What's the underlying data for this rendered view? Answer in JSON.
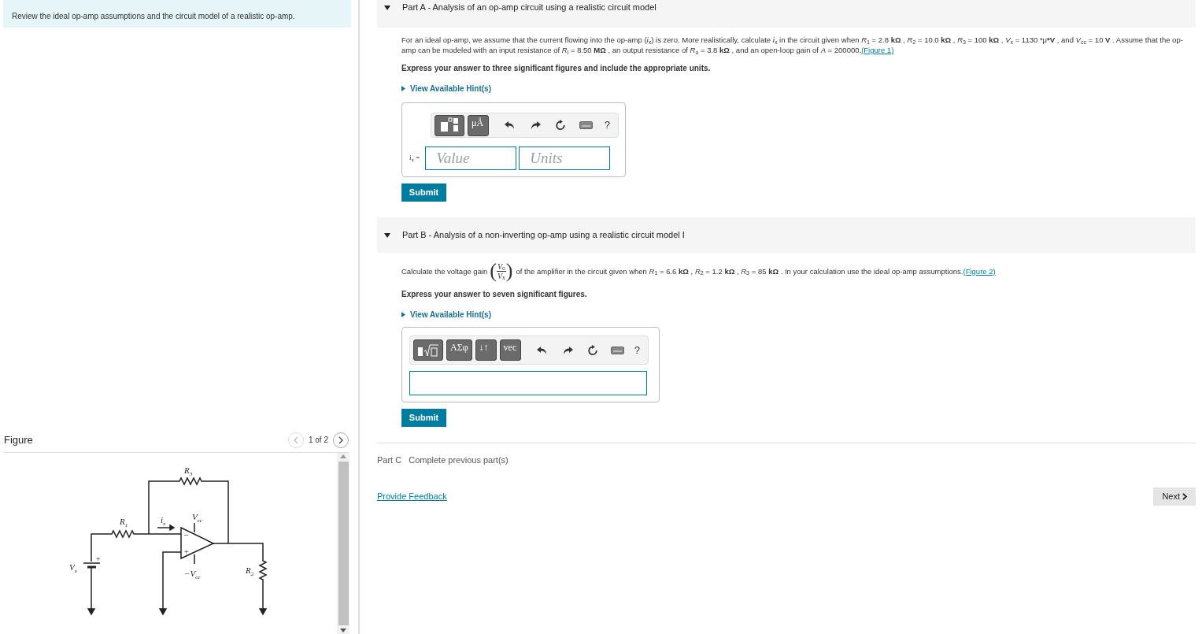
{
  "intro": {
    "text": "Review the ideal op-amp assumptions and the circuit model of a realistic op-amp."
  },
  "figure": {
    "title": "Figure",
    "pager": {
      "label": "1 of 2",
      "prev_disabled": true,
      "next_disabled": false
    },
    "labels": [
      {
        "main": "R",
        "sub": "3"
      },
      {
        "main": "R",
        "sub": "1"
      },
      {
        "main": "i",
        "sub": "x"
      },
      {
        "main": "V",
        "sub": "cc"
      },
      {
        "main": "−V",
        "sub": "cc"
      },
      {
        "main": "V",
        "sub": "x"
      },
      {
        "main": "R",
        "sub": "2"
      },
      {
        "main": "+"
      },
      {
        "main": "−"
      },
      {
        "main": "+"
      }
    ]
  },
  "parts": [
    {
      "kind": "answer",
      "title": "Part A - Analysis of an op-amp circuit using a realistic circuit model",
      "expanded": true,
      "question": "For an ideal op-amp, we assume that the current flowing into the op-amp (*i*$_{x}$) is zero. More realistically, calculate *i*$_{x}$ in the circuit given when *R*$_{1}$ = 2.8 **kΩ** , *R*$_{2}$ = 10.0 **kΩ** , *R*$_{3}$ = 100 **kΩ** , *V*$_{x}$ = 1130 *μ***V** , and *V*$_{cc}$ = 10 **V** . Assume that the op-amp can be modeled with an input resistance of *R*$_{i}$ = 8.50 **MΩ** , an output resistance of *R*$_{o}$ = 3.8 **kΩ** , and an open-loop  gain of *A* = 200000.",
      "link": "(Figure 1)",
      "instruction": "Express your answer to three significant figures and include the appropriate units.",
      "hint": {
        "label": "View Available Hint(s)",
        "expanded": false
      },
      "toolbar": [
        {
          "kind": "templates"
        },
        {
          "kind": "symbol",
          "label": "μÅ"
        },
        {
          "kind": "undo"
        },
        {
          "kind": "redo"
        },
        {
          "kind": "reset"
        },
        {
          "kind": "keyboard"
        },
        {
          "kind": "help",
          "label": "?"
        }
      ],
      "answer": {
        "kind": "value-units",
        "label": "*i*$_{x}$ =",
        "value_placeholder": "Value",
        "units_placeholder": "Units"
      },
      "submit": "Submit"
    },
    {
      "kind": "answer",
      "title": "Part B - Analysis of a non-inverting op-amp using a realistic circuit model I",
      "expanded": true,
      "question_before": "Calculate the voltage gain",
      "fraction": {
        "open": "(",
        "numerator": "*V*$_{o}$",
        "denominator": "*V*$_{x}$",
        "close": ")"
      },
      "question": "of the amplifier in the circuit given when *R*$_{1}$ = 6.6 **kΩ** , *R*$_{2}$ = 1.2 **kΩ** , *R*$_{3}$ = 85 **kΩ** .  In your calculation use the ideal op-amp assumptions.",
      "link": "(Figure 2)",
      "instruction": "Express your answer to seven significant figures.",
      "hint": {
        "label": "View Available Hint(s)",
        "expanded": false
      },
      "toolbar": [
        {
          "kind": "radical"
        },
        {
          "kind": "symbol",
          "label": "ΑΣφ"
        },
        {
          "kind": "symbol",
          "label": "↓↑"
        },
        {
          "kind": "symbol",
          "label": "vec"
        },
        {
          "kind": "undo"
        },
        {
          "kind": "redo"
        },
        {
          "kind": "reset"
        },
        {
          "kind": "keyboard"
        },
        {
          "kind": "help",
          "label": "?"
        }
      ],
      "answer": {
        "kind": "plain"
      },
      "submit": "Submit"
    },
    {
      "kind": "locked",
      "label": "Part C",
      "status": "Complete previous part(s)"
    }
  ],
  "feedback_link": "Provide Feedback",
  "next_button": "Next"
}
